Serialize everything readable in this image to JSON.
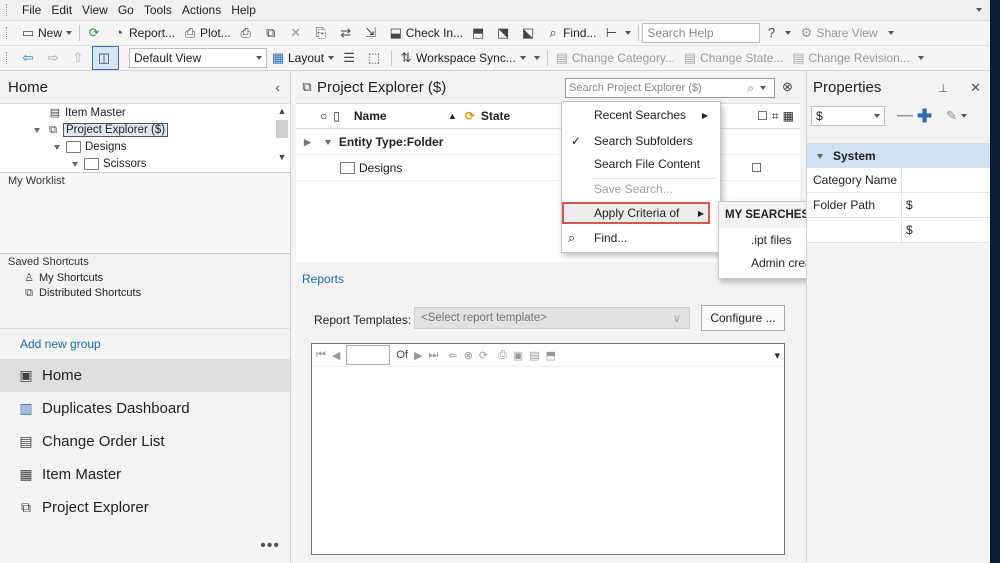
{
  "menubar": {
    "items": [
      "File",
      "Edit",
      "View",
      "Go",
      "Tools",
      "Actions",
      "Help"
    ]
  },
  "toolbar": {
    "new_label": "New",
    "report_label": "Report...",
    "plot_label": "Plot...",
    "check_in_label": "Check In...",
    "find_label": "Find...",
    "search_help_placeholder": "Search Help",
    "share_view_label": "Share View",
    "default_view": "Default View",
    "layout_label": "Layout",
    "workspace_sync_label": "Workspace Sync...",
    "change_category_label": "Change Category...",
    "change_state_label": "Change State...",
    "change_revision_label": "Change Revision..."
  },
  "left": {
    "title": "Home",
    "tree": {
      "item_master": "Item Master",
      "project_explorer": "Project Explorer ($)",
      "designs": "Designs",
      "scissors": "Scissors"
    },
    "worklist_title": "My Worklist",
    "saved_shortcuts_title": "Saved Shortcuts",
    "shortcuts": [
      "My Shortcuts",
      "Distributed Shortcuts"
    ],
    "add_group": "Add new group",
    "nav": [
      "Home",
      "Duplicates Dashboard",
      "Change Order List",
      "Item Master",
      "Project Explorer"
    ],
    "more": "•••"
  },
  "center": {
    "title": "Project Explorer ($)",
    "search_placeholder": "Search Project Explorer ($)",
    "columns": {
      "name": "Name",
      "state": "State"
    },
    "group_row": "Entity Type:Folder",
    "rows": [
      "Designs"
    ],
    "reports_link": "Reports",
    "report_templates_label": "Report Templates:",
    "report_template_placeholder": "<Select report template>",
    "configure_label": "Configure ...",
    "viewer_of": "Of"
  },
  "search_menu": {
    "items": [
      "Recent Searches",
      "Search Subfolders",
      "Search File Content",
      "Save Search...",
      "Apply Criteria of",
      "Find..."
    ],
    "submenu_header": "MY SEARCHES",
    "submenu_items": [
      ".ipt files",
      "Admin creation"
    ]
  },
  "properties": {
    "title": "Properties",
    "combo": "$",
    "group": "System",
    "rows": [
      {
        "k": "Category Name",
        "v": ""
      },
      {
        "k": "Folder Path",
        "v": "$"
      },
      {
        "k": "",
        "v": "$"
      }
    ]
  },
  "colors": {
    "accent": "#1a67b5",
    "highlight_border": "#d9534f"
  }
}
